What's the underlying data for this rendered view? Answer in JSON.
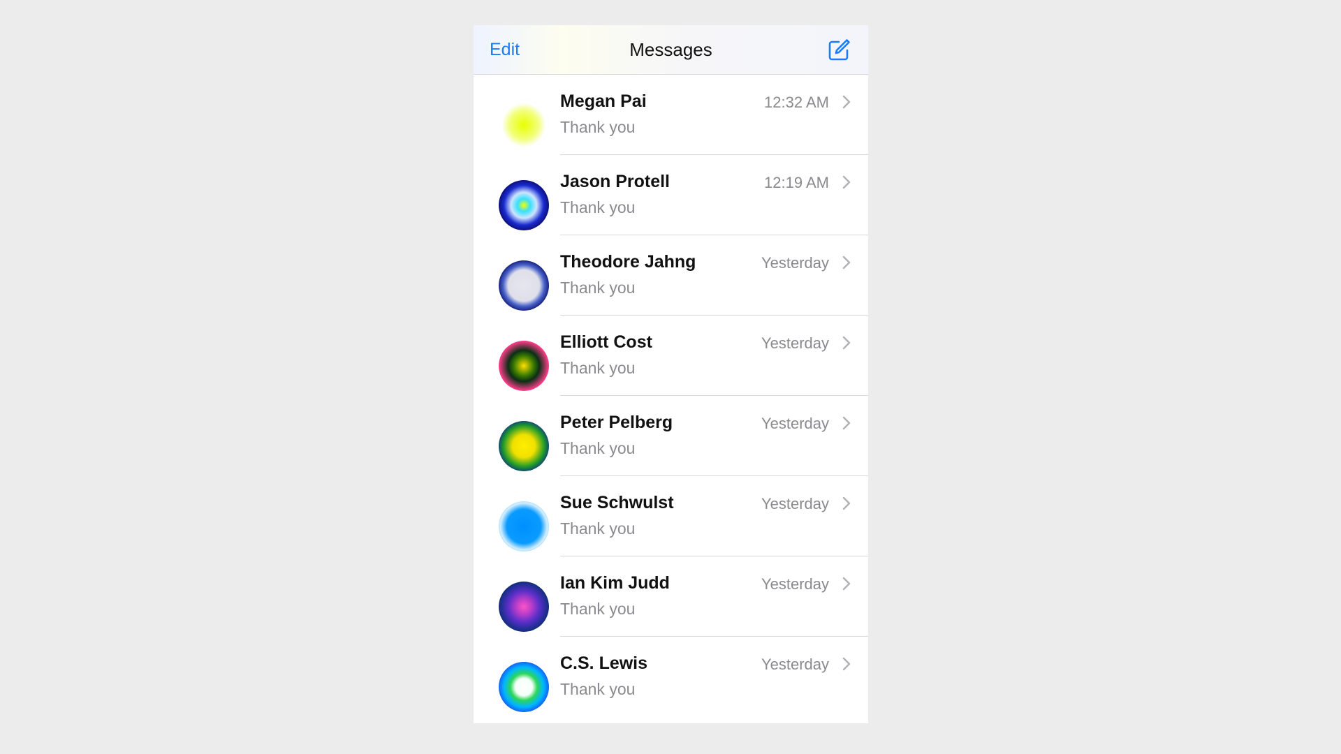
{
  "nav": {
    "edit_label": "Edit",
    "title": "Messages",
    "compose_icon": "compose-icon"
  },
  "colors": {
    "accent": "#1a7cf5",
    "secondary_text": "#8a8a8e"
  },
  "conversations": [
    {
      "name": "Megan Pai",
      "preview": "Thank you",
      "time": "12:32 AM",
      "avatar_gradient": "radial-gradient(circle, #e8ff00 0%, #f2ff7a 40%, #ffffff 62%, #ffffff 70%, #00e05a 78%, #00ff66 86%, #ffffff 100%)"
    },
    {
      "name": "Jason Protell",
      "preview": "Thank you",
      "time": "12:19 AM",
      "avatar_gradient": "radial-gradient(circle, #f5ff00 0%, #36e0ff 18%, #cde4ff 36%, #1a2bd0 56%, #0a0a6a 74%, #ff1fa0 88%, #ffb6e2 100%)"
    },
    {
      "name": "Theodore Jahng",
      "preview": "Thank you",
      "time": "Yesterday",
      "avatar_gradient": "radial-gradient(circle, #e6e6ee 0%, #dedfea 44%, #4a62c9 58%, #0c1470 74%, #eaff00 86%, #ffffff 100%)"
    },
    {
      "name": "Elliott Cost",
      "preview": "Thank you",
      "time": "Yesterday",
      "avatar_gradient": "radial-gradient(circle, #ffe000 0%, #3a7a00 28%, #0b2e16 44%, #ff3d8b 70%, #ffc7dc 100%)"
    },
    {
      "name": "Peter Pelberg",
      "preview": "Thank you",
      "time": "Yesterday",
      "avatar_gradient": "radial-gradient(circle, #ffee00 0%, #f0e000 32%, #1f9a2a 58%, #0b2d8a 76%, #ff3fc0 90%, #ffd4ef 100%)"
    },
    {
      "name": "Sue Schwulst",
      "preview": "Thank you",
      "time": "Yesterday",
      "avatar_gradient": "radial-gradient(circle, #0090ff 0%, #0a9bff 48%, #d5efff 66%, #5ec0ff 82%, #e9f6ff 100%)"
    },
    {
      "name": "Ian Kim Judd",
      "preview": "Thank you",
      "time": "Yesterday",
      "avatar_gradient": "radial-gradient(circle, #ff54c7 0%, #b83dc9 22%, #5a2fc8 44%, #1b2e8f 66%, #0a2a10 84%, #eef7c6 100%)"
    },
    {
      "name": "C.S. Lewis",
      "preview": "Thank you",
      "time": "Yesterday",
      "avatar_gradient": "radial-gradient(circle, #ffffff 0%, #f4fff8 24%, #2bd65a 38%, #00b6ff 56%, #1a45f0 76%, #1b1bd8 94%, #ffffff 100%)"
    }
  ]
}
